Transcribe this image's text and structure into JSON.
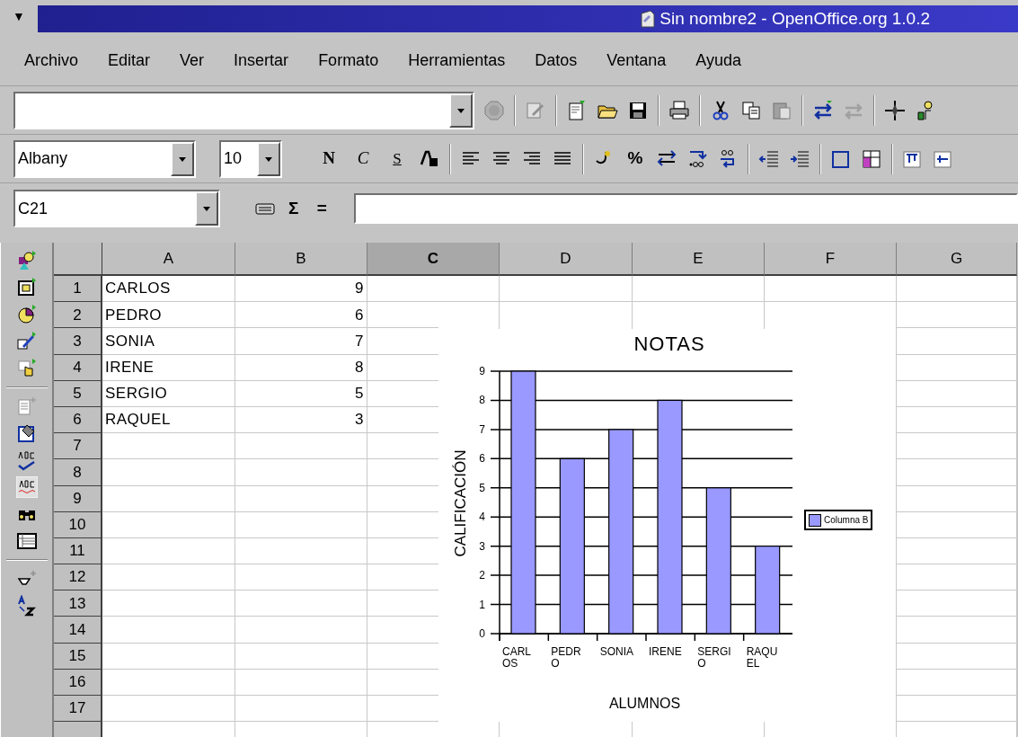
{
  "window": {
    "menu_glyph": "▼",
    "title": "Sin nombre2 - OpenOffice.org 1.0.2"
  },
  "menu": [
    "Archivo",
    "Editar",
    "Ver",
    "Insertar",
    "Formato",
    "Herramientas",
    "Datos",
    "Ventana",
    "Ayuda"
  ],
  "object_bar": {
    "font": "Albany",
    "size": "10",
    "bold": "N",
    "italic": "C",
    "underline": "S",
    "percent": "%"
  },
  "formula_bar": {
    "cell_ref": "C21",
    "sum": "Σ",
    "equals": "="
  },
  "sheet": {
    "columns": [
      {
        "label": "A",
        "selected": false
      },
      {
        "label": "B",
        "selected": false
      },
      {
        "label": "C",
        "selected": true
      },
      {
        "label": "D",
        "selected": false
      },
      {
        "label": "E",
        "selected": false
      },
      {
        "label": "F",
        "selected": false
      },
      {
        "label": "G",
        "selected": false
      }
    ],
    "rows": [
      {
        "number": "1",
        "cells": [
          "CARLOS",
          "9"
        ]
      },
      {
        "number": "2",
        "cells": [
          "PEDRO",
          "6"
        ]
      },
      {
        "number": "3",
        "cells": [
          "SONIA",
          "7"
        ]
      },
      {
        "number": "4",
        "cells": [
          "IRENE",
          "8"
        ]
      },
      {
        "number": "5",
        "cells": [
          "SERGIO",
          "5"
        ]
      },
      {
        "number": "6",
        "cells": [
          "RAQUEL",
          "3"
        ]
      },
      {
        "number": "7",
        "cells": []
      },
      {
        "number": "8",
        "cells": []
      },
      {
        "number": "9",
        "cells": []
      },
      {
        "number": "10",
        "cells": []
      },
      {
        "number": "11",
        "cells": []
      },
      {
        "number": "12",
        "cells": []
      },
      {
        "number": "13",
        "cells": []
      },
      {
        "number": "14",
        "cells": []
      },
      {
        "number": "15",
        "cells": []
      },
      {
        "number": "16",
        "cells": []
      },
      {
        "number": "17",
        "cells": []
      }
    ],
    "chart_data": {
      "type": "bar",
      "title": "NOTAS",
      "xlabel": "ALUMNOS",
      "ylabel": "CALIFICACIÓN",
      "categories": [
        "CARLOS",
        "PEDRO",
        "SONIA",
        "IRENE",
        "SERGIO",
        "RAQUEL"
      ],
      "series": [
        {
          "name": "Columna B",
          "color": "#9999ff",
          "values": [
            9,
            6,
            7,
            8,
            5,
            3
          ]
        }
      ],
      "ylim": [
        0,
        9
      ],
      "grid": true,
      "yticks": [
        0,
        1,
        2,
        3,
        4,
        5,
        6,
        7,
        8,
        9
      ]
    }
  }
}
